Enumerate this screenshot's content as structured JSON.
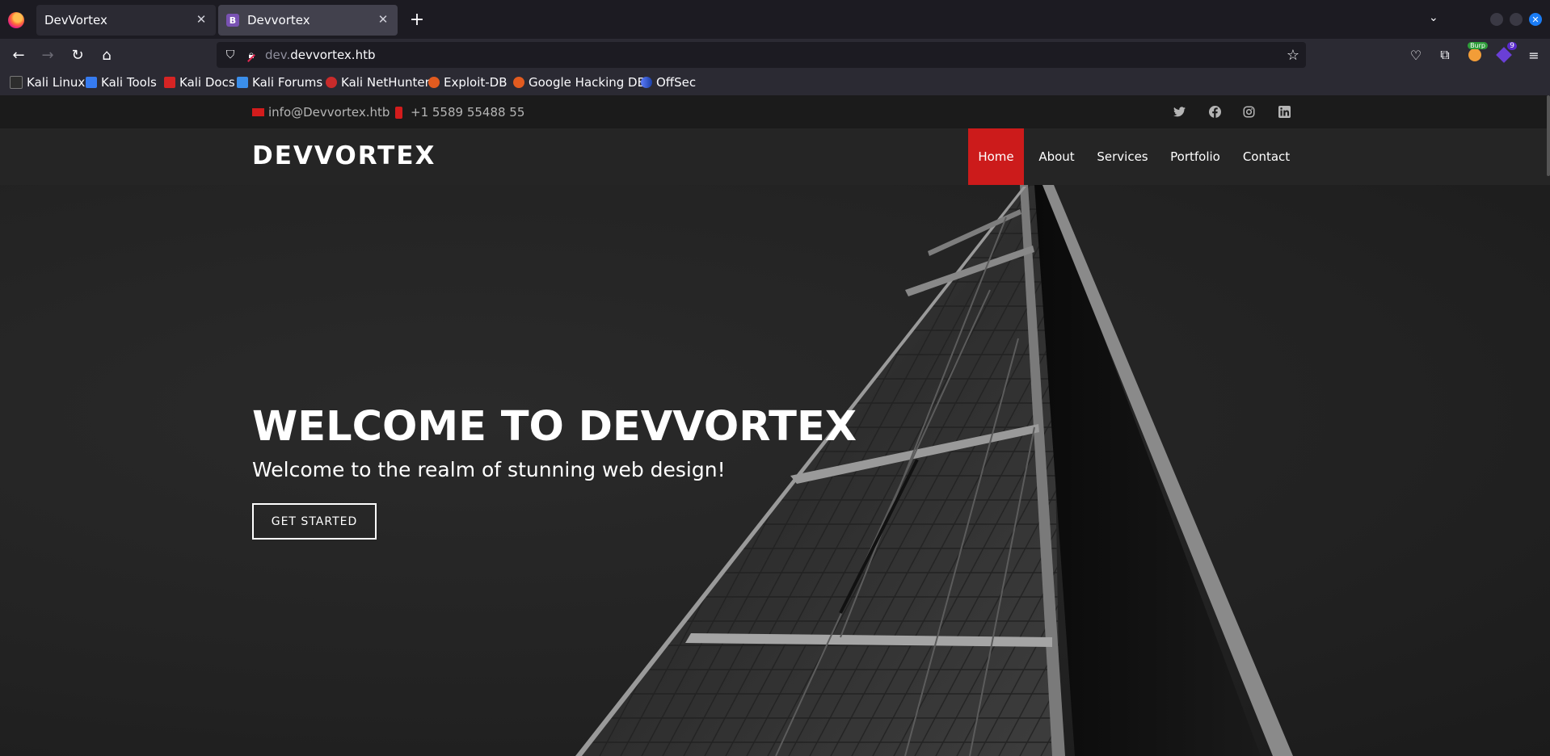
{
  "browser": {
    "tabs": [
      {
        "title": "DevVortex",
        "active": false
      },
      {
        "title": "Devvortex",
        "active": true,
        "favicon": "B"
      }
    ],
    "new_tab_symbol": "+",
    "url_subdomain": "dev.",
    "url_domain": "devvortex.htb",
    "extension_badge": "9",
    "extension_label": "Burp",
    "bookmarks": [
      "Kali Linux",
      "Kali Tools",
      "Kali Docs",
      "Kali Forums",
      "Kali NetHunter",
      "Exploit-DB",
      "Google Hacking DB",
      "OffSec"
    ]
  },
  "site": {
    "email": "info@Devvortex.htb",
    "phone": "+1 5589 55488 55",
    "social_icons": [
      "twitter-icon",
      "facebook-icon",
      "instagram-icon",
      "linkedin-icon"
    ],
    "logo": "DEVVORTEX",
    "nav": [
      {
        "label": "Home",
        "active": true
      },
      {
        "label": "About",
        "active": false
      },
      {
        "label": "Services",
        "active": false
      },
      {
        "label": "Portfolio",
        "active": false
      },
      {
        "label": "Contact",
        "active": false
      }
    ],
    "hero": {
      "title": "WELCOME TO DEVVORTEX",
      "subtitle": "Welcome to the realm of stunning web design!",
      "button": "GET STARTED"
    }
  },
  "colors": {
    "accent": "#cc1b1b",
    "browser_bg": "#1c1b22",
    "toolbar_bg": "#2b2a33"
  }
}
